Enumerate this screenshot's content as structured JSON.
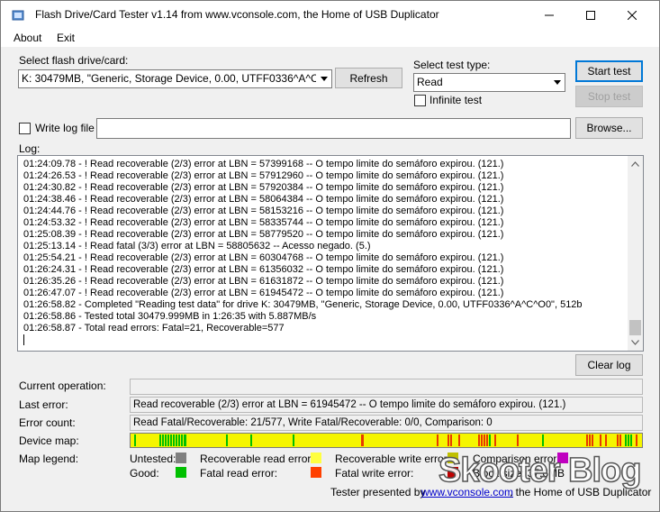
{
  "window": {
    "title": "Flash Drive/Card Tester v1.14 from www.vconsole.com, the Home of USB Duplicator",
    "minimize_glyph": "—",
    "maximize_glyph": "☐",
    "close_glyph": "✕"
  },
  "menu": {
    "about": "About",
    "exit": "Exit"
  },
  "drive": {
    "label": "Select flash drive/card:",
    "selected": "K: 30479MB, \"Generic, Storage Device, 0.00, UTFF0336^A^C^O0\"",
    "refresh_label": "Refresh"
  },
  "test": {
    "label": "Select test type:",
    "selected": "Read",
    "infinite_label": "Infinite test",
    "infinite_checked": false,
    "start_label": "Start test",
    "stop_label": "Stop test"
  },
  "logfile": {
    "write_label": "Write log file",
    "checked": false,
    "path": "",
    "browse_label": "Browse..."
  },
  "log": {
    "label": "Log:",
    "lines": [
      "01:24:09.78 - ! Read recoverable (2/3) error at LBN = 57399168 -- O tempo limite do semáforo expirou. (121.)",
      "01:24:26.53 - ! Read recoverable (2/3) error at LBN = 57912960 -- O tempo limite do semáforo expirou. (121.)",
      "01:24:30.82 - ! Read recoverable (2/3) error at LBN = 57920384 -- O tempo limite do semáforo expirou. (121.)",
      "01:24:38.46 - ! Read recoverable (2/3) error at LBN = 58064384 -- O tempo limite do semáforo expirou. (121.)",
      "01:24:44.76 - ! Read recoverable (2/3) error at LBN = 58153216 -- O tempo limite do semáforo expirou. (121.)",
      "01:24:53.32 - ! Read recoverable (2/3) error at LBN = 58335744 -- O tempo limite do semáforo expirou. (121.)",
      "01:25:08.39 - ! Read recoverable (2/3) error at LBN = 58779520 -- O tempo limite do semáforo expirou. (121.)",
      "01:25:13.14 - ! Read fatal (3/3) error at LBN = 58805632 -- Acesso negado. (5.)",
      "01:25:54.21 - ! Read recoverable (2/3) error at LBN = 60304768 -- O tempo limite do semáforo expirou. (121.)",
      "01:26:24.31 - ! Read recoverable (2/3) error at LBN = 61356032 -- O tempo limite do semáforo expirou. (121.)",
      "01:26:35.26 - ! Read recoverable (2/3) error at LBN = 61631872 -- O tempo limite do semáforo expirou. (121.)",
      "01:26:47.07 - ! Read recoverable (2/3) error at LBN = 61945472 -- O tempo limite do semáforo expirou. (121.)",
      "01:26:58.82 - Completed \"Reading test data\" for drive K: 30479MB, \"Generic, Storage Device, 0.00, UTFF0336^A^C^O0\", 512b",
      "01:26:58.86 - Tested total 30479.999MB in 1:26:35 with  5.887MB/s",
      "01:26:58.87 - Total read errors: Fatal=21, Recoverable=577"
    ],
    "clear_label": "Clear log"
  },
  "status": {
    "current_operation_label": "Current operation:",
    "current_operation": "",
    "last_error_label": "Last error:",
    "last_error": "Read recoverable (2/3) error at LBN = 61945472 -- O tempo limite do semáforo expirou. (121.)",
    "error_count_label": "Error count:",
    "error_count": "Read Fatal/Recoverable: 21/577, Write Fatal/Recoverable: 0/0, Comparison: 0",
    "device_map_label": "Device map:",
    "map_legend_label": "Map legend:"
  },
  "device_map": {
    "colors": {
      "Y": "#f5f500",
      "G": "#00c000",
      "R": "#e83a00"
    },
    "cells": "YGYYYYYYYYGGGGGGGGGGYYYYYYYYYYYYYYGYYYYYYYYGYYYYYYYYYYYYYYGYYYYYYYYYYYYYYYYYYYYYYYYRYYYYYYYYYYYYYYYYYYYYYYYYYYRYYYRRYYRYYYYYYRRRRGYRYYYYYYYRYYYYYYYYGYYYYYYYYYYYYYYYRRRYYRYRYYYRRYGGGYRY"
  },
  "legend": {
    "untested_label": "Untested:",
    "good_label": "Good:",
    "recoverable_read_label": "Recoverable read error:",
    "fatal_read_label": "Fatal read error:",
    "recoverable_write_label": "Recoverable write error:",
    "fatal_write_label": "Fatal write error:",
    "comparison_label": "Comparison error:",
    "block_size_label": "Block size: 37.6MB",
    "colors": {
      "untested": "#808080",
      "good": "#00c000",
      "recoverable_read": "#ffff40",
      "fatal_read": "#ff4000",
      "recoverable_write": "#c0c000",
      "fatal_write": "#c00000",
      "comparison": "#c000c0"
    }
  },
  "footer": {
    "prefix": "Tester presented by",
    "link": "www.vconsole.com",
    "suffix": ", the Home of USB Duplicator"
  },
  "watermark": "Skooter Blog"
}
